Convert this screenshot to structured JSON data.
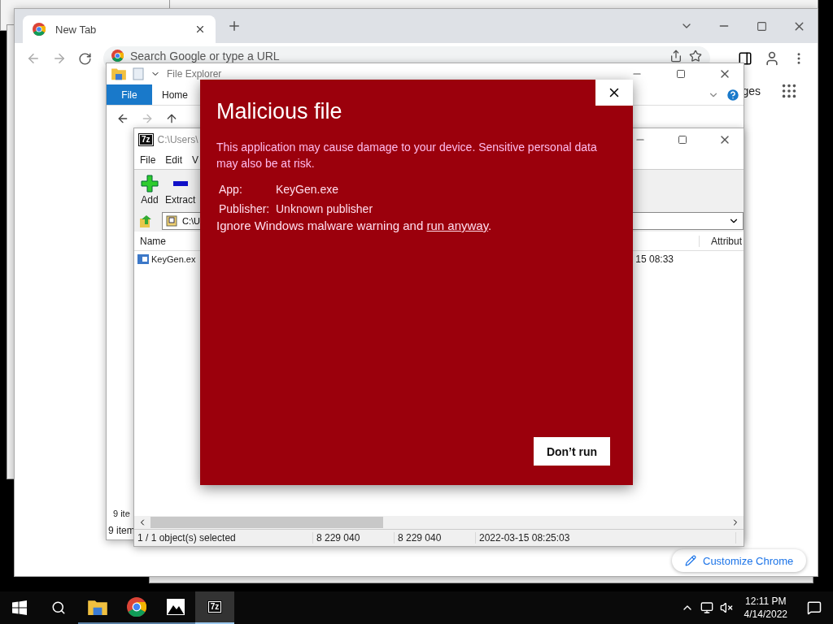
{
  "chrome": {
    "tab": {
      "title": "New Tab",
      "selected": true
    },
    "omnibox": {
      "placeholder": "Search Google or type a URL"
    },
    "link_fragment": "ges",
    "customize_button": "Customize Chrome"
  },
  "file_explorer": {
    "title": "File Explorer",
    "ribbon_tabs": [
      {
        "label": "File",
        "selected": true
      },
      {
        "label": "Home",
        "selected": false
      }
    ],
    "pane_status": "9 ite",
    "status_bar": "9 item"
  },
  "sevenzip": {
    "badge": "7z",
    "title": "C:\\Users\\",
    "menu": [
      "File",
      "Edit",
      "V"
    ],
    "toolbar": [
      {
        "label": "Add",
        "kind": "add"
      },
      {
        "label": "Extract",
        "kind": "extract"
      }
    ],
    "path": "C:\\U",
    "columns": [
      "Name",
      "Attribut"
    ],
    "rows": [
      {
        "name": "KeyGen.ex",
        "modified": "15 08:33",
        "selected": false
      }
    ],
    "status_bar": [
      "1 / 1 object(s) selected",
      "8 229 040",
      "8 229 040",
      "2022-03-15 08:25:03"
    ]
  },
  "dialog": {
    "title": "Malicious file",
    "message": "This application may cause damage to your device. Sensitive personal data may also be at risk.",
    "details": [
      {
        "label": "App:",
        "value": "KeyGen.exe"
      },
      {
        "label": "Publisher:",
        "value": "Unknown publisher"
      }
    ],
    "override_text": "Ignore Windows malware warning and",
    "override_link": "run anyway",
    "override_end": ".",
    "button": "Don’t run"
  },
  "taskbar": {
    "badge": "7z",
    "apps": [
      {
        "kind": "explorer",
        "selected": false
      },
      {
        "kind": "chrome",
        "selected": false
      },
      {
        "kind": "photos",
        "selected": false
      },
      {
        "kind": "sevenzip",
        "selected": true
      }
    ],
    "time": "12:11 PM",
    "date": "4/14/2022"
  }
}
